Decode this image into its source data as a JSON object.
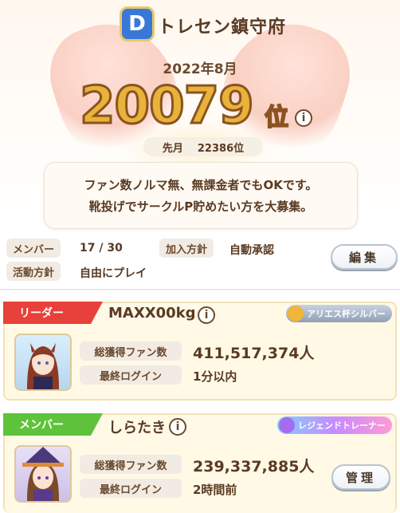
{
  "circle": {
    "name": "トレセン鎮守府",
    "logo_letter": "D"
  },
  "ranking": {
    "month": "2022年8月",
    "rank": "20079",
    "unit": "位",
    "prev_label": "先月",
    "prev_value": "22386位"
  },
  "description": {
    "line1": "ファン数ノルマ無、無課金者でもOKです。",
    "line2": "靴投げでサークルP貯めたい方を大募集。"
  },
  "info": {
    "members_label": "メンバー",
    "members_value": "17 / 30",
    "join_label": "加入方針",
    "join_value": "自動承認",
    "policy_label": "活動方針",
    "policy_value": "自由にプレイ"
  },
  "buttons": {
    "edit": "編集",
    "manage": "管理"
  },
  "members": [
    {
      "role": "リーダー",
      "name": "MAXX00kg",
      "badge": "アリエス杯シルバー",
      "fans_label": "総獲得ファン数",
      "fans": "411,517,374人",
      "login_label": "最終ログイン",
      "login": "1分以内"
    },
    {
      "role": "メンバー",
      "name": "しらたき",
      "badge": "レジェンドトレーナー",
      "fans_label": "総獲得ファン数",
      "fans": "239,337,885人",
      "login_label": "最終ログイン",
      "login": "2時間前"
    }
  ],
  "colors": {
    "leader_role": "#e8403a",
    "member_role": "#5ec33a",
    "rank_gold": "#e9b23a"
  },
  "icons": {
    "info": "info-icon"
  }
}
